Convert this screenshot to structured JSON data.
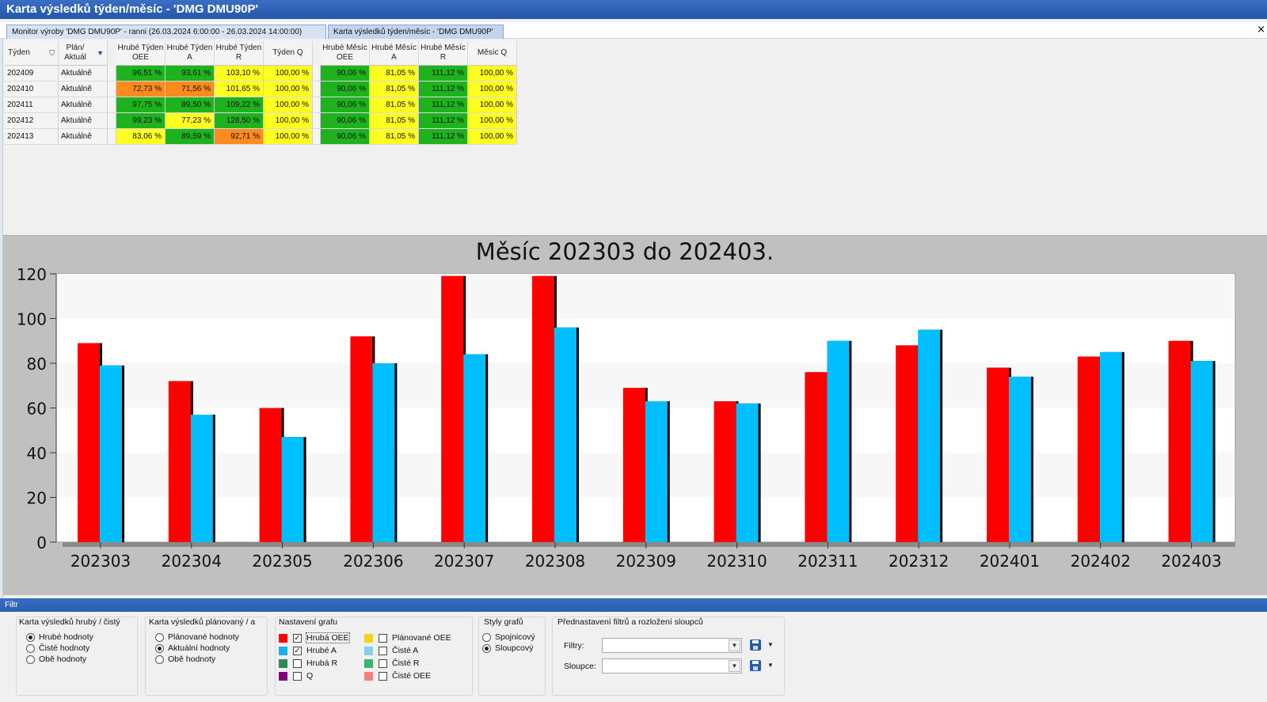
{
  "window": {
    "title": "Karta výsledků týden/měsíc - 'DMG DMU90P'"
  },
  "tabs": [
    {
      "label": "Monitor výroby 'DMG DMU90P' - ranni (26.03.2024 6:00:00 - 26.03.2024 14:00:00)"
    },
    {
      "label": "Karta výsledků týden/měsíc - 'DMG DMU90P'"
    }
  ],
  "tab_close": "×",
  "table": {
    "columns": [
      {
        "label": "Týden"
      },
      {
        "label": "Plán/ Aktuál"
      },
      {
        "label": "Hrubé Týden OEE"
      },
      {
        "label": "Hrubé Týden A"
      },
      {
        "label": "Hrubé Týden R"
      },
      {
        "label": "Týden Q"
      },
      {
        "label": "Hrubé Měsíc OEE"
      },
      {
        "label": "Hrubé Měsíc A"
      },
      {
        "label": "Hrubé Měsíc R"
      },
      {
        "label": "Měsíc Q"
      }
    ],
    "rows": [
      {
        "week": "202409",
        "plan": "Aktuálně",
        "values": [
          "96,51 %",
          "93,61 %",
          "103,10 %",
          "100,00 %",
          "90,06 %",
          "81,05 %",
          "111,12 %",
          "100,00 %"
        ],
        "colors": [
          "g",
          "g",
          "y",
          "y",
          "g",
          "y",
          "g",
          "y"
        ]
      },
      {
        "week": "202410",
        "plan": "Aktuálně",
        "values": [
          "72,73 %",
          "71,56 %",
          "101,65 %",
          "100,00 %",
          "90,06 %",
          "81,05 %",
          "111,12 %",
          "100,00 %"
        ],
        "colors": [
          "o",
          "o",
          "y",
          "y",
          "g",
          "y",
          "g",
          "y"
        ]
      },
      {
        "week": "202411",
        "plan": "Aktuálně",
        "values": [
          "97,75 %",
          "89,50 %",
          "109,22 %",
          "100,00 %",
          "90,06 %",
          "81,05 %",
          "111,12 %",
          "100,00 %"
        ],
        "colors": [
          "g",
          "g",
          "g",
          "y",
          "g",
          "y",
          "g",
          "y"
        ]
      },
      {
        "week": "202412",
        "plan": "Aktuálně",
        "values": [
          "99,23 %",
          "77,23 %",
          "128,50 %",
          "100,00 %",
          "90,06 %",
          "81,05 %",
          "111,12 %",
          "100,00 %"
        ],
        "colors": [
          "g",
          "y",
          "g",
          "y",
          "g",
          "y",
          "g",
          "y"
        ]
      },
      {
        "week": "202413",
        "plan": "Aktuálně",
        "values": [
          "83,06 %",
          "89,59 %",
          "92,71 %",
          "100,00 %",
          "90,06 %",
          "81,05 %",
          "111,12 %",
          "100,00 %"
        ],
        "colors": [
          "y",
          "g",
          "o",
          "y",
          "g",
          "y",
          "g",
          "y"
        ]
      }
    ],
    "cell_colors": {
      "g": "#1fb21f",
      "y": "#ffff22",
      "o": "#ff8a1e"
    }
  },
  "chart_data": {
    "type": "bar",
    "title": "Měsíc 202303 do 202403.",
    "categories": [
      "202303",
      "202304",
      "202305",
      "202306",
      "202307",
      "202308",
      "202309",
      "202310",
      "202311",
      "202312",
      "202401",
      "202402",
      "202403"
    ],
    "series": [
      {
        "name": "Hrubá OEE",
        "color": "#ff0000",
        "values": [
          89,
          72,
          60,
          92,
          119,
          119,
          69,
          63,
          76,
          88,
          78,
          83,
          90
        ]
      },
      {
        "name": "Hrubé A",
        "color": "#00bfff",
        "values": [
          79,
          57,
          47,
          80,
          84,
          96,
          63,
          62,
          90,
          95,
          74,
          85,
          81
        ]
      }
    ],
    "ylim": [
      0,
      120
    ],
    "yticks": [
      0,
      20,
      40,
      60,
      80,
      100,
      120
    ],
    "xlabel": "",
    "ylabel": "",
    "grid": "horizontal bands",
    "legend": "none"
  },
  "filter": {
    "bar_label": "Filtr",
    "group1": {
      "title": "Karta výsledků hrubý / čistý",
      "options": [
        {
          "label": "Hrubé hodnoty",
          "selected": true
        },
        {
          "label": "Čisté hodnoty",
          "selected": false
        },
        {
          "label": "Obě hodnoty",
          "selected": false
        }
      ]
    },
    "group2": {
      "title": "Karta výsledků plánovaný / a",
      "options": [
        {
          "label": "Plánované hodnoty",
          "selected": false
        },
        {
          "label": "Aktuální hodnoty",
          "selected": true
        },
        {
          "label": "Obě hodnoty",
          "selected": false
        }
      ]
    },
    "group3": {
      "title": "Nastavení grafu",
      "items": [
        {
          "label": "Hrubá OEE",
          "color": "#ff0000",
          "checked": true
        },
        {
          "label": "Hrubé A",
          "color": "#1ab0e8",
          "checked": true
        },
        {
          "label": "Hrubá R",
          "color": "#2e8b57",
          "checked": false
        },
        {
          "label": "Q",
          "color": "#800080",
          "checked": false
        },
        {
          "label": "Plánované OEE",
          "color": "#f5d020",
          "checked": false
        },
        {
          "label": "Čisté A",
          "color": "#87ceeb",
          "checked": false
        },
        {
          "label": "Čisté R",
          "color": "#3cb371",
          "checked": false
        },
        {
          "label": "Čisté OEE",
          "color": "#f08080",
          "checked": false
        }
      ]
    },
    "group4": {
      "title": "Styly grafů",
      "options": [
        {
          "label": "Spojnicový",
          "selected": false
        },
        {
          "label": "Sloupcový",
          "selected": true
        }
      ]
    },
    "group5": {
      "title": "Přednastavení filtrů a rozložení sloupců",
      "filters_label": "Filtry:",
      "columns_label": "Sloupce:",
      "filters_value": "",
      "columns_value": ""
    }
  }
}
